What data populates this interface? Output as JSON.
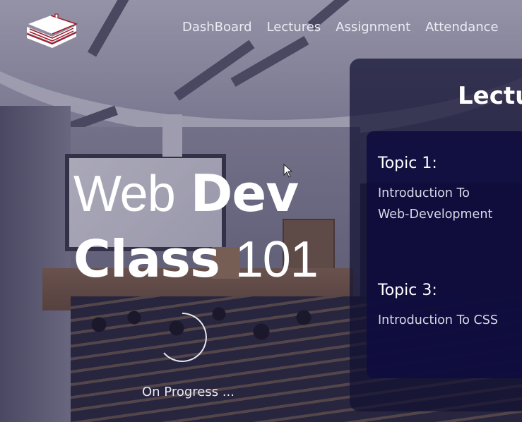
{
  "nav": {
    "items": [
      {
        "label": "DashBoard"
      },
      {
        "label": "Lectures"
      },
      {
        "label": "Assignment"
      },
      {
        "label": "Attendance"
      }
    ]
  },
  "hero": {
    "line1_light": "Web",
    "line1_bold": "Dev",
    "line2_bold": "Class",
    "line2_light": "101",
    "progress_text": "On Progress ..."
  },
  "panel": {
    "title": "Lectu",
    "topics": [
      {
        "title": "Topic 1:",
        "description_lines": [
          "Introduction To",
          "Web-Development"
        ]
      },
      {
        "title": "Topic 3:",
        "description_lines": [
          "Introduction To CSS"
        ]
      }
    ]
  },
  "colors": {
    "logo_accent": "#a01c2a",
    "panel_bg": "#120f32",
    "card_bg": "#0e0c3e"
  }
}
